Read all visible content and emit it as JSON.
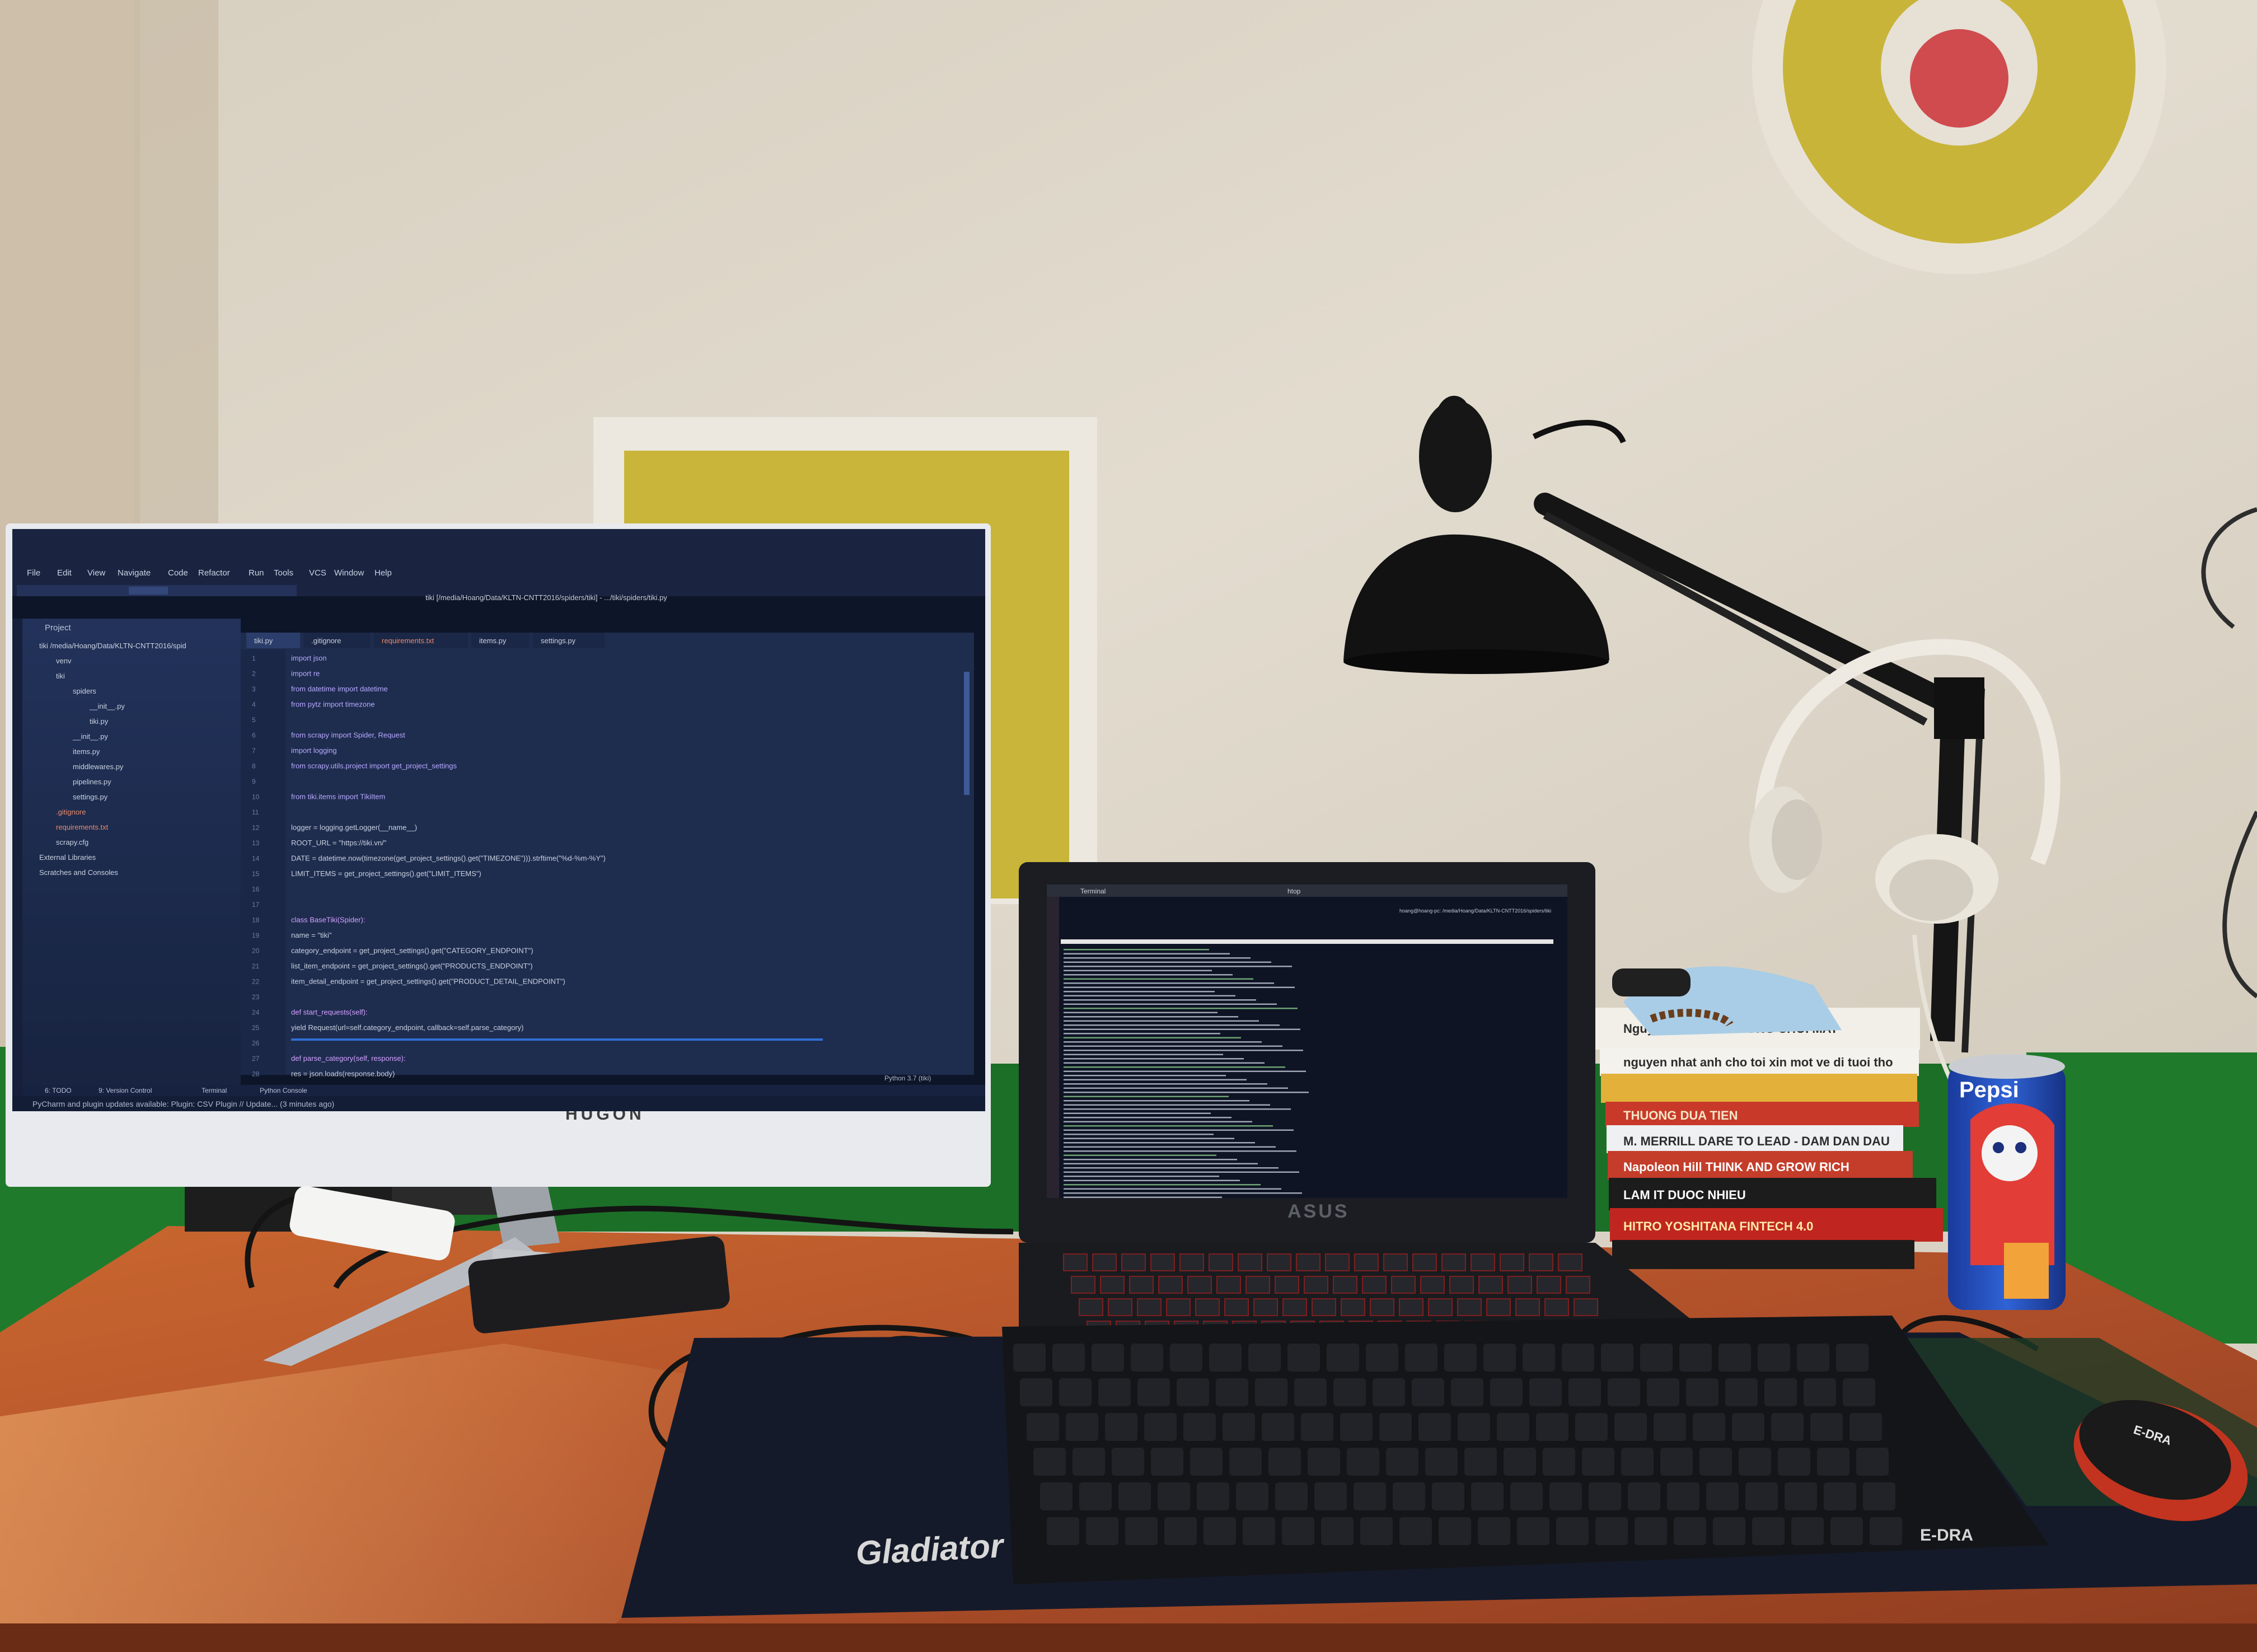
{
  "monitor": {
    "brand": "HUGON",
    "ide": {
      "title": "tiki [/media/Hoang/Data/KLTN-CNTT2016/spiders/tiki] - .../tiki/spiders/tiki.py",
      "menu": [
        "File",
        "Edit",
        "View",
        "Navigate",
        "Code",
        "Refactor",
        "Run",
        "Tools",
        "VCS",
        "Window",
        "Help"
      ],
      "project_label": "Project",
      "tabs": [
        "tiki.py",
        ".gitignore",
        "requirements.txt",
        "items.py",
        "settings.py"
      ],
      "tree": [
        "tiki  /media/Hoang/Data/KLTN-CNTT2016/spid",
        "venv",
        "tiki",
        "spiders",
        "__init__.py",
        "tiki.py",
        "__init__.py",
        "items.py",
        "middlewares.py",
        "pipelines.py",
        "settings.py",
        ".gitignore",
        "requirements.txt",
        "scrapy.cfg",
        "External Libraries",
        "Scratches and Consoles"
      ],
      "line_numbers": [
        "1",
        "2",
        "3",
        "4",
        "5",
        "6",
        "7",
        "8",
        "9",
        "10",
        "11",
        "12",
        "13",
        "14",
        "15",
        "16",
        "17",
        "18",
        "19",
        "20",
        "21",
        "22",
        "23",
        "24",
        "25",
        "26",
        "27",
        "28"
      ],
      "code": [
        "import json",
        "import re",
        "from datetime import datetime",
        "from pytz import timezone",
        "",
        "from scrapy import Spider, Request",
        "import logging",
        "from scrapy.utils.project import get_project_settings",
        "",
        "from tiki.items import TikiItem",
        "",
        "logger = logging.getLogger(__name__)",
        "ROOT_URL = \"https://tiki.vn/\"",
        "DATE = datetime.now(timezone(get_project_settings().get(\"TIMEZONE\"))).strftime(\"%d-%m-%Y\")",
        "LIMIT_ITEMS = get_project_settings().get(\"LIMIT_ITEMS\")",
        "",
        "",
        "class BaseTiki(Spider):",
        "    name = \"tiki\"",
        "    category_endpoint = get_project_settings().get(\"CATEGORY_ENDPOINT\")",
        "    list_item_endpoint = get_project_settings().get(\"PRODUCTS_ENDPOINT\")",
        "    item_detail_endpoint = get_project_settings().get(\"PRODUCT_DETAIL_ENDPOINT\")",
        "",
        "    def start_requests(self):",
        "        yield Request(url=self.category_endpoint, callback=self.parse_category)",
        "",
        "    def parse_category(self, response):",
        "        res = json.loads(response.body)"
      ],
      "bottom_tabs": [
        "6: TODO",
        "9: Version Control",
        "Terminal",
        "Python Console"
      ],
      "status_message": "PyCharm and plugin updates available: Plugin: CSV Plugin // Update... (3 minutes ago)",
      "status_right": "Python 3.7 (tiki)"
    }
  },
  "laptop": {
    "brand": "ASUS",
    "terminal_title": "htop",
    "terminal_tab": "Terminal",
    "prompt": "hoang@hoang-pc: /media/Hoang/Data/KLTN-CNTT2016/spiders/tiki"
  },
  "books": [
    "Nguyen Gioi Nhat      TRONG CHOI MAT",
    "nguyen nhat anh   cho toi xin mot ve di tuoi tho",
    "",
    "THUONG DUA TIEN",
    "M. MERRILL  DARE TO LEAD - DAM DAN DAU",
    "Napoleon Hill   THINK AND GROW RICH",
    "LAM IT DUOC NHIEU",
    "HITRO YOSHITANA        FINTECH 4.0"
  ],
  "keyboard_brand": "E-DRA",
  "mousepad_text": "Gladiator",
  "mouse_brand": "E-DRA",
  "can_brand": "Pepsi",
  "colors": {
    "wall": "#d9d2c4",
    "wall_green": "#1e7a2a",
    "desk": "#b5522a",
    "ide_bg": "#1c2a49",
    "terminal_bg": "#0e1424",
    "target_yellow": "#c9b43a",
    "target_red": "#cf4b4e"
  }
}
